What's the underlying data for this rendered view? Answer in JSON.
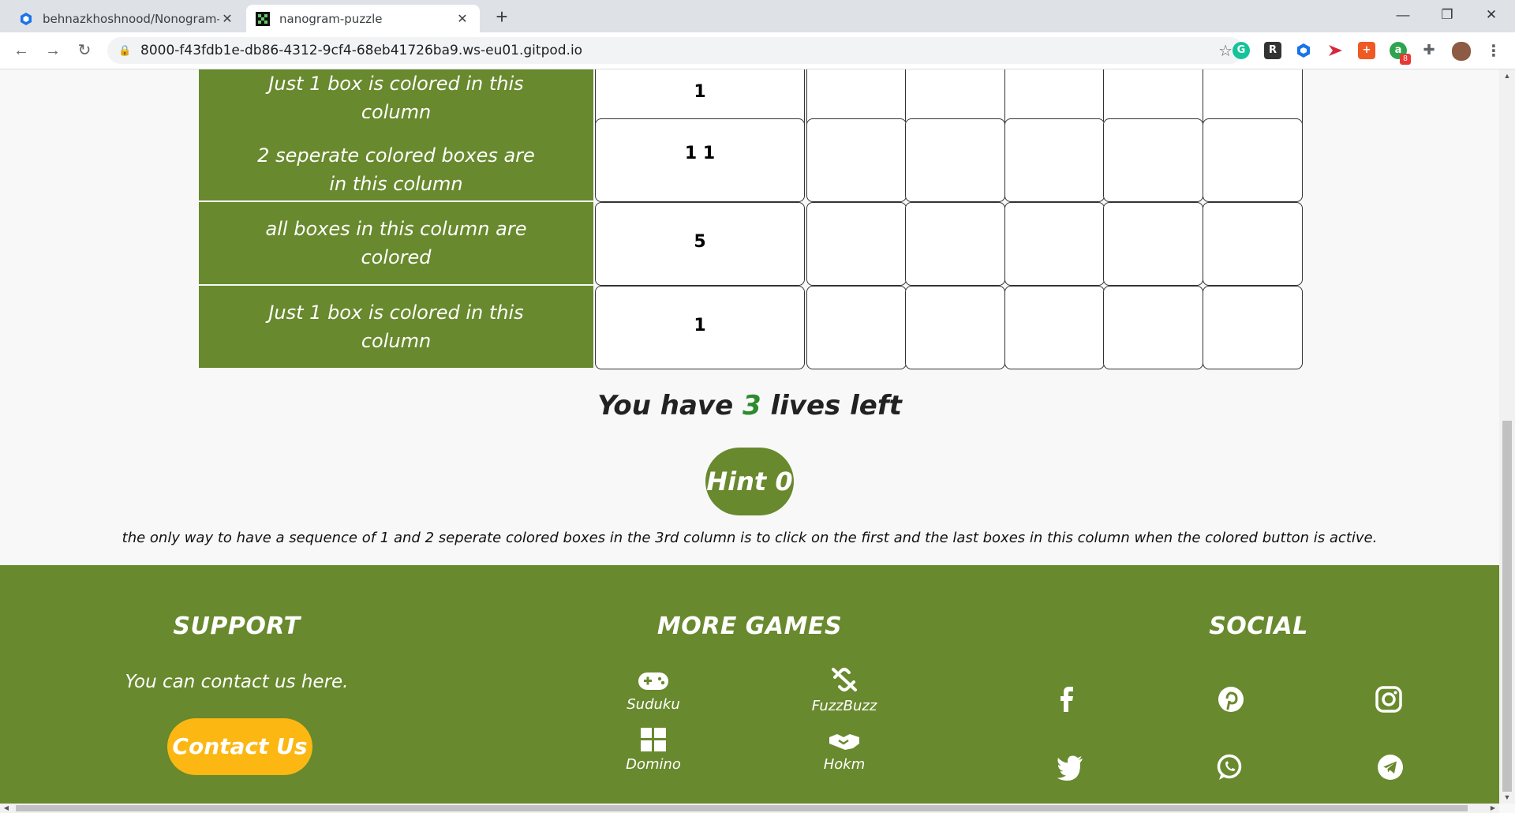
{
  "browser": {
    "tabs": [
      {
        "title": "behnazkhoshnood/Nonogram-p",
        "active": false
      },
      {
        "title": "nanogram-puzzle",
        "active": true
      }
    ],
    "url": "8000-f43fdb1e-db86-4312-9cf4-68eb41726ba9.ws-eu01.gitpod.io",
    "extension_badge": "8"
  },
  "puzzle": {
    "rows": [
      {
        "hint": "Just 1 box is colored in this column",
        "clue": "1"
      },
      {
        "hint": "2 seperate colored boxes are in this column",
        "clue": "1 1"
      },
      {
        "hint": "all boxes in this column are colored",
        "clue": "5"
      },
      {
        "hint": "Just 1 box is colored in this column",
        "clue": "1"
      }
    ],
    "lives_prefix": "You have",
    "lives_count": "3",
    "lives_suffix": "lives left",
    "hint_button": "Hint 0",
    "hint_text": "the only way to have a sequence of 1 and 2 seperate colored boxes in the 3rd column is to click on the first and the last boxes in this column when the colored button is active."
  },
  "footer": {
    "support": {
      "heading": "SUPPORT",
      "text": "You can contact us here.",
      "button": "Contact Us"
    },
    "more_games": {
      "heading": "MORE GAMES",
      "games": [
        {
          "label": "Suduku",
          "icon": "gamepad-icon"
        },
        {
          "label": "FuzzBuzz",
          "icon": "broken-link-icon"
        },
        {
          "label": "Domino",
          "icon": "grid-icon"
        },
        {
          "label": "Hokm",
          "icon": "handshake-icon"
        }
      ]
    },
    "social": {
      "heading": "SOCIAL",
      "icons": [
        "facebook-icon",
        "pinterest-icon",
        "instagram-icon",
        "twitter-icon",
        "whatsapp-icon",
        "telegram-icon"
      ]
    }
  },
  "colors": {
    "green": "#68892d",
    "yellow": "#fcb713",
    "lives_green": "#2d8a2d"
  }
}
